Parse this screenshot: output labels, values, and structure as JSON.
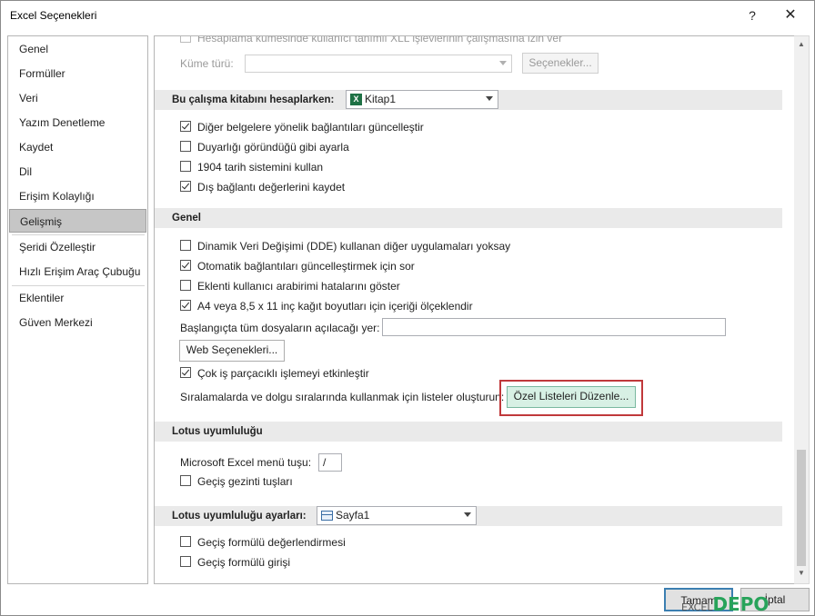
{
  "window": {
    "title": "Excel Seçenekleri",
    "help_glyph": "?",
    "close_glyph": "✕"
  },
  "sidebar": {
    "items": [
      {
        "label": "Genel"
      },
      {
        "label": "Formüller"
      },
      {
        "label": "Veri"
      },
      {
        "label": "Yazım Denetleme"
      },
      {
        "label": "Kaydet"
      },
      {
        "label": "Dil"
      },
      {
        "label": "Erişim Kolaylığı"
      },
      {
        "label": "Gelişmiş",
        "selected": true
      },
      {
        "label": "Şeridi Özelleştir"
      },
      {
        "label": "Hızlı Erişim Araç Çubuğu"
      },
      {
        "label": "Eklentiler"
      },
      {
        "label": "Güven Merkezi"
      }
    ]
  },
  "content": {
    "top_partial_text": "Hesaplama kümesinde kullanıcı tanımlı XLL işlevlerinin çalışmasına izin ver",
    "kume_turu_label": "Küme türü:",
    "kume_turu_value": "",
    "secenekler_button": "Seçenekler...",
    "section_workbook": {
      "label": "Bu çalışma kitabını hesaplarken:",
      "workbook_value": "Kitap1",
      "options": [
        {
          "label": "Diğer belgelere yönelik bağlantıları güncelleştir",
          "checked": true
        },
        {
          "label": "Duyarlığı göründüğü gibi ayarla",
          "checked": false
        },
        {
          "label": "1904 tarih sistemini kullan",
          "checked": false
        },
        {
          "label": "Dış bağlantı değerlerini kaydet",
          "checked": true
        }
      ]
    },
    "section_general": {
      "label": "Genel",
      "options": [
        {
          "label": "Dinamik Veri Değişimi (DDE) kullanan diğer uygulamaları yoksay",
          "checked": false
        },
        {
          "label": "Otomatik bağlantıları güncelleştirmek için sor",
          "checked": true
        },
        {
          "label": "Eklenti kullanıcı arabirimi hatalarını göster",
          "checked": false
        },
        {
          "label": "A4 veya 8,5 x 11 inç kağıt boyutları için içeriği ölçeklendir",
          "checked": true
        }
      ],
      "startup_label": "Başlangıçta tüm dosyaların açılacağı yer:",
      "startup_value": "",
      "web_options_button": "Web Seçenekleri...",
      "multithread_label": "Çok iş parçacıklı işlemeyi etkinleştir",
      "multithread_checked": true,
      "custom_lists_label": "Sıralamalarda ve dolgu sıralarında kullanmak için listeler oluşturun:",
      "custom_lists_button": "Özel Listeleri Düzenle..."
    },
    "section_lotus": {
      "label": "Lotus uyumluluğu",
      "menu_key_label": "Microsoft Excel menü tuşu:",
      "menu_key_value": "/",
      "nav_keys_label": "Geçiş gezinti tuşları",
      "nav_keys_checked": false
    },
    "section_lotus_settings": {
      "label": "Lotus uyumluluğu ayarları:",
      "sheet_value": "Sayfa1",
      "options": [
        {
          "label": "Geçiş formülü değerlendirmesi",
          "checked": false
        },
        {
          "label": "Geçiş formülü girişi",
          "checked": false
        }
      ]
    }
  },
  "footer": {
    "ok": "Tamam",
    "cancel": "İptal"
  },
  "watermark": {
    "prefix": "EXCEL",
    "brand": "DEPO"
  },
  "colors": {
    "highlight_border": "#c0393b",
    "selected_item": "#c6c6c6",
    "section_bg": "#eaeaea"
  }
}
